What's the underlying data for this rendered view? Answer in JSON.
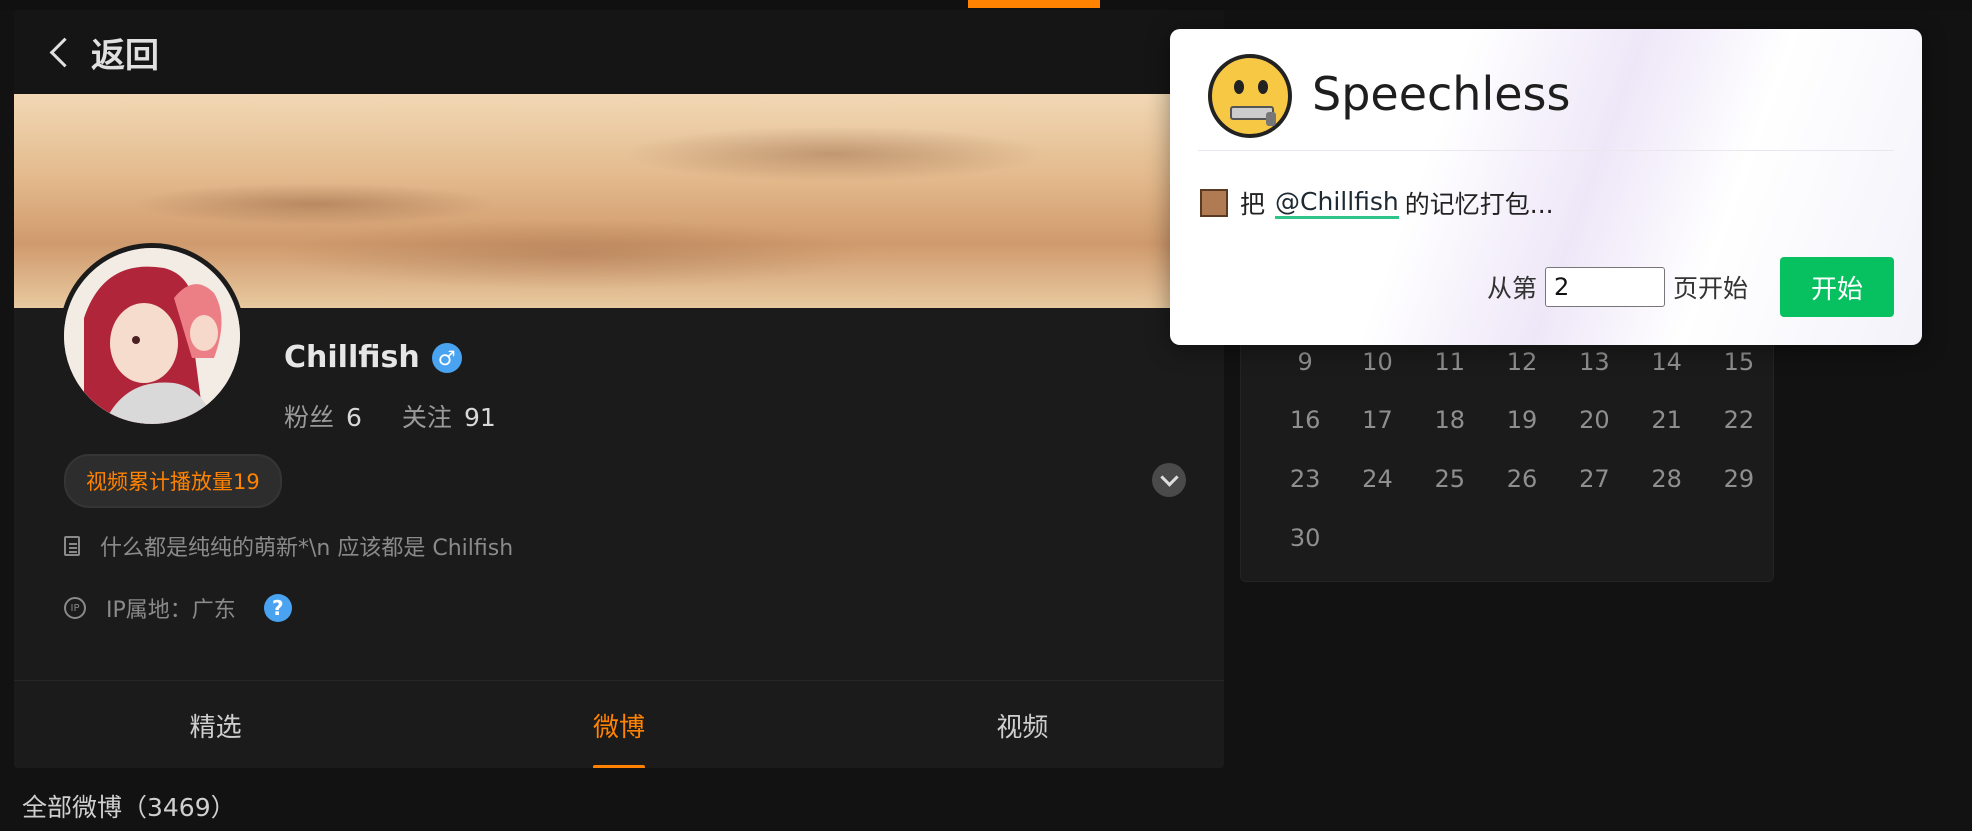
{
  "header": {
    "back_label": "返回"
  },
  "profile": {
    "name": "Chillfish",
    "gender_symbol": "♂",
    "fans_label": "粉丝",
    "fans_count": "6",
    "follow_label": "关注",
    "follow_count": "91",
    "badge": "视频累计播放量19",
    "bio": "什么都是纯纯的萌新*\\n 应该都是 Chilfish",
    "ip_label": "IP属地：广东",
    "ip_icon_text": "IP",
    "help_symbol": "?"
  },
  "tabs": [
    {
      "label": "精选"
    },
    {
      "label": "微博"
    },
    {
      "label": "视频"
    }
  ],
  "active_tab": "微博",
  "feed": {
    "all_label": "全部微博（3469）"
  },
  "calendar": {
    "rows": [
      [
        "9",
        "10",
        "11",
        "12",
        "13",
        "14",
        "15"
      ],
      [
        "16",
        "17",
        "18",
        "19",
        "20",
        "21",
        "22"
      ],
      [
        "23",
        "24",
        "25",
        "26",
        "27",
        "28",
        "29"
      ],
      [
        "30"
      ]
    ]
  },
  "popup": {
    "title": "Speechless",
    "msg_prefix": "把",
    "user": "@Chillfish",
    "msg_suffix": "的记忆打包...",
    "from_label": "从第",
    "page_value": "2",
    "page_suffix": "页开始",
    "start_button": "开始"
  },
  "colors": {
    "accent": "#ff8200",
    "start_green": "#07c160",
    "verify_blue": "#4aa3f0"
  }
}
